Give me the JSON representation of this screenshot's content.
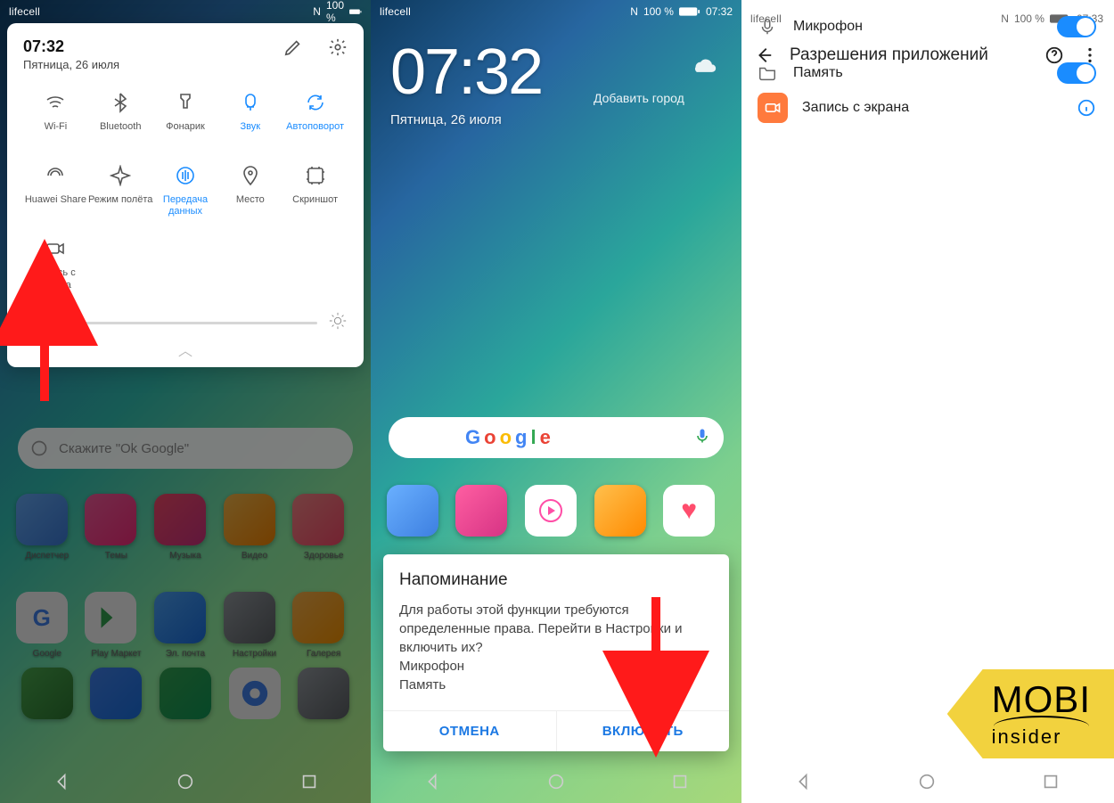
{
  "status": {
    "carrier": "lifecell",
    "nfc": "N",
    "battery": "100 %",
    "time1": "07:32",
    "time3": "07:33"
  },
  "phone1": {
    "time": "07:32",
    "date": "Пятница, 26 июля",
    "tiles": [
      {
        "name": "wifi",
        "label": "Wi-Fi",
        "active": false
      },
      {
        "name": "bluetooth",
        "label": "Bluetooth",
        "active": false
      },
      {
        "name": "flashlight",
        "label": "Фонарик",
        "active": false
      },
      {
        "name": "sound",
        "label": "Звук",
        "active": true
      },
      {
        "name": "autorotate",
        "label": "Автоповорот",
        "active": true
      },
      {
        "name": "huaweishare",
        "label": "Huawei Share",
        "active": false
      },
      {
        "name": "airplane",
        "label": "Режим полёта",
        "active": false
      },
      {
        "name": "mobiledata",
        "label": "Передача данных",
        "active": true
      },
      {
        "name": "location",
        "label": "Место",
        "active": false
      },
      {
        "name": "screenshot",
        "label": "Скриншот",
        "active": false
      },
      {
        "name": "screenrec",
        "label": "Запись с экрана",
        "active": false
      }
    ],
    "brightness_percent": 14,
    "search_placeholder": "Скажите \"Ok Google\"",
    "apps_row1": [
      "Диспетчер",
      "Темы",
      "Музыка",
      "Видео",
      "Здоровье"
    ],
    "apps_row2": [
      "Google",
      "Play Маркет",
      "Эл. почта",
      "Настройки",
      "Галерея"
    ]
  },
  "phone2": {
    "clock": "07:32",
    "add_city": "Добавить город",
    "date": "Пятница, 26 июля",
    "dialog": {
      "title": "Напоминание",
      "body": "Для работы этой функции требуются определенные права. Перейти в Настройки и включить их?\nМикрофон\nПамять",
      "cancel": "ОТМЕНА",
      "confirm": "ВКЛЮЧИТЬ"
    }
  },
  "phone3": {
    "header": "Разрешения приложений",
    "app_name": "Запись с экрана",
    "perms": [
      {
        "icon": "mic",
        "label": "Микрофон",
        "on": true
      },
      {
        "icon": "folder",
        "label": "Память",
        "on": true
      }
    ]
  },
  "watermark": {
    "top": "MOBI",
    "bottom": "insider"
  }
}
